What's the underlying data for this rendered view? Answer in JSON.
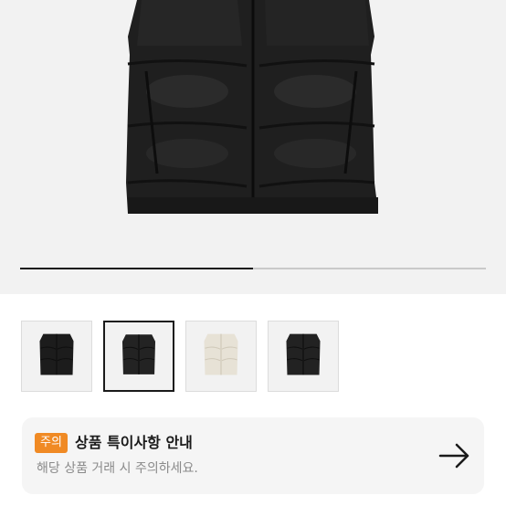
{
  "product_image": {
    "alt_icon": "puffer-vest-image"
  },
  "gallery": {
    "progress_fraction": 0.5,
    "thumbnails": [
      {
        "name": "black-vest-front",
        "color": "#1c1c1c",
        "selected": false
      },
      {
        "name": "black-vest-alt",
        "color": "#232323",
        "selected": true
      },
      {
        "name": "cream-vest",
        "color": "#e7e2d6",
        "selected": false
      },
      {
        "name": "black-vest-logo",
        "color": "#222222",
        "selected": false
      }
    ]
  },
  "notice": {
    "badge": "주의",
    "title": "상품 특이사항 안내",
    "subtitle": "해당 상품 거래 시 주의하세요.",
    "arrow_icon": "arrow-right-icon",
    "badge_color": "#f08a24"
  }
}
